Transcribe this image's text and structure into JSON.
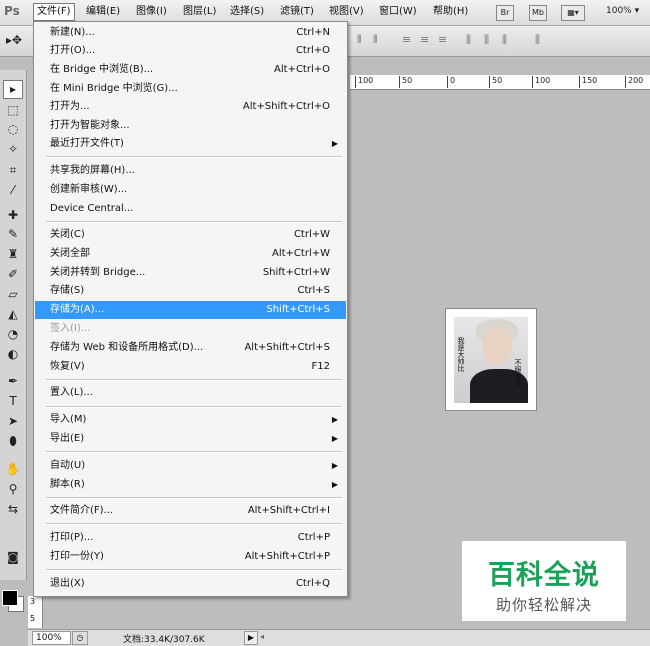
{
  "app": {
    "logo": "Ps",
    "menus": [
      "文件(F)",
      "编辑(E)",
      "图像(I)",
      "图层(L)",
      "选择(S)",
      "滤镜(T)",
      "视图(V)",
      "窗口(W)",
      "帮助(H)"
    ],
    "bar_buttons": [
      "Br",
      "Mb"
    ],
    "zoom_select": "100%"
  },
  "ruler": {
    "top_labels": [
      "100",
      "50",
      "0",
      "50",
      "100",
      "150",
      "200"
    ]
  },
  "file_menu": {
    "items": [
      {
        "label": "新建(N)...",
        "shortcut": "Ctrl+N"
      },
      {
        "label": "打开(O)...",
        "shortcut": "Ctrl+O"
      },
      {
        "label": "在 Bridge 中浏览(B)...",
        "shortcut": "Alt+Ctrl+O"
      },
      {
        "label": "在 Mini Bridge 中浏览(G)...",
        "shortcut": ""
      },
      {
        "label": "打开为...",
        "shortcut": "Alt+Shift+Ctrl+O"
      },
      {
        "label": "打开为智能对象...",
        "shortcut": ""
      },
      {
        "label": "最近打开文件(T)",
        "shortcut": ""
      },
      {
        "label": "共享我的屏幕(H)...",
        "shortcut": ""
      },
      {
        "label": "创建新审核(W)...",
        "shortcut": ""
      },
      {
        "label": "Device Central...",
        "shortcut": ""
      },
      {
        "label": "关闭(C)",
        "shortcut": "Ctrl+W"
      },
      {
        "label": "关闭全部",
        "shortcut": "Alt+Ctrl+W"
      },
      {
        "label": "关闭并转到 Bridge...",
        "shortcut": "Shift+Ctrl+W"
      },
      {
        "label": "存储(S)",
        "shortcut": "Ctrl+S"
      },
      {
        "label": "存储为(A)...",
        "shortcut": "Shift+Ctrl+S"
      },
      {
        "label": "签入(I)...",
        "shortcut": ""
      },
      {
        "label": "存储为 Web 和设备所用格式(D)...",
        "shortcut": "Alt+Shift+Ctrl+S"
      },
      {
        "label": "恢复(V)",
        "shortcut": "F12"
      },
      {
        "label": "置入(L)...",
        "shortcut": ""
      },
      {
        "label": "导入(M)",
        "shortcut": ""
      },
      {
        "label": "导出(E)",
        "shortcut": ""
      },
      {
        "label": "自动(U)",
        "shortcut": ""
      },
      {
        "label": "脚本(R)",
        "shortcut": ""
      },
      {
        "label": "文件简介(F)...",
        "shortcut": "Alt+Shift+Ctrl+I"
      },
      {
        "label": "打印(P)...",
        "shortcut": "Ctrl+P"
      },
      {
        "label": "打印一份(Y)",
        "shortcut": "Alt+Shift+Ctrl+P"
      },
      {
        "label": "退出(X)",
        "shortcut": "Ctrl+Q"
      }
    ]
  },
  "image_text": {
    "left": "我是大帅比",
    "right": "不服来战"
  },
  "watermark": {
    "title": "百科全说",
    "subtitle": "助你轻松解决"
  },
  "status": {
    "zoom": "100%",
    "doc_info": "文档:33.4K/307.6K"
  },
  "ruler_left": [
    "3",
    "5"
  ],
  "colors": {
    "highlight": "#3399ff",
    "watermark_green": "#1aa259"
  }
}
